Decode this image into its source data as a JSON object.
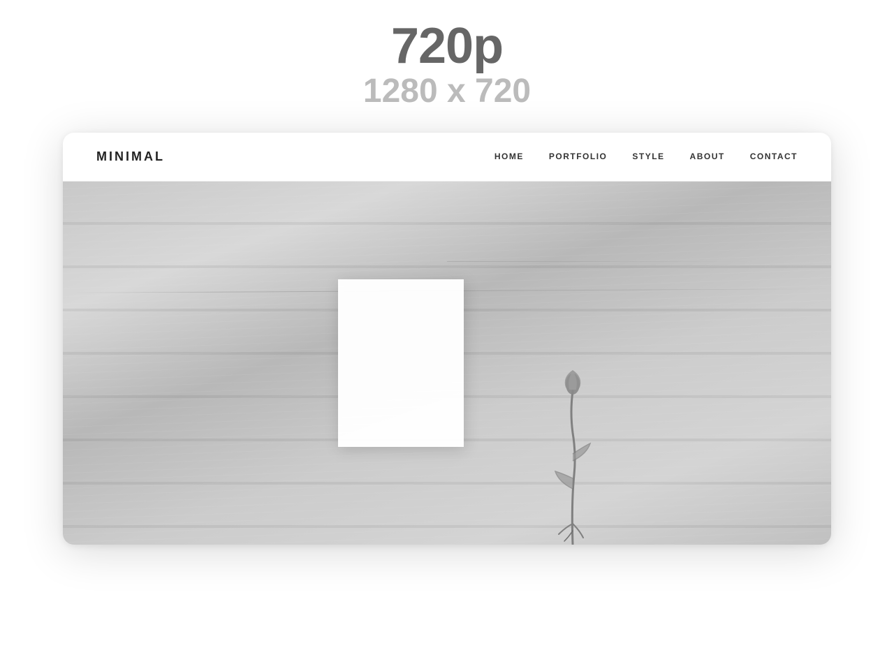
{
  "resolution": {
    "label": "720p",
    "dimensions": "1280 x 720"
  },
  "site": {
    "logo": "MINIMAL",
    "nav": {
      "items": [
        {
          "label": "HOME",
          "id": "home"
        },
        {
          "label": "PORTFOLIO",
          "id": "portfolio"
        },
        {
          "label": "STYLE",
          "id": "style"
        },
        {
          "label": "ABOUT",
          "id": "about"
        },
        {
          "label": "CONTACT",
          "id": "contact"
        }
      ]
    }
  },
  "colors": {
    "background": "#ffffff",
    "text_dark": "#222222",
    "text_medium": "#666666",
    "text_light": "#bbbbbb",
    "border": "#eeeeee"
  }
}
